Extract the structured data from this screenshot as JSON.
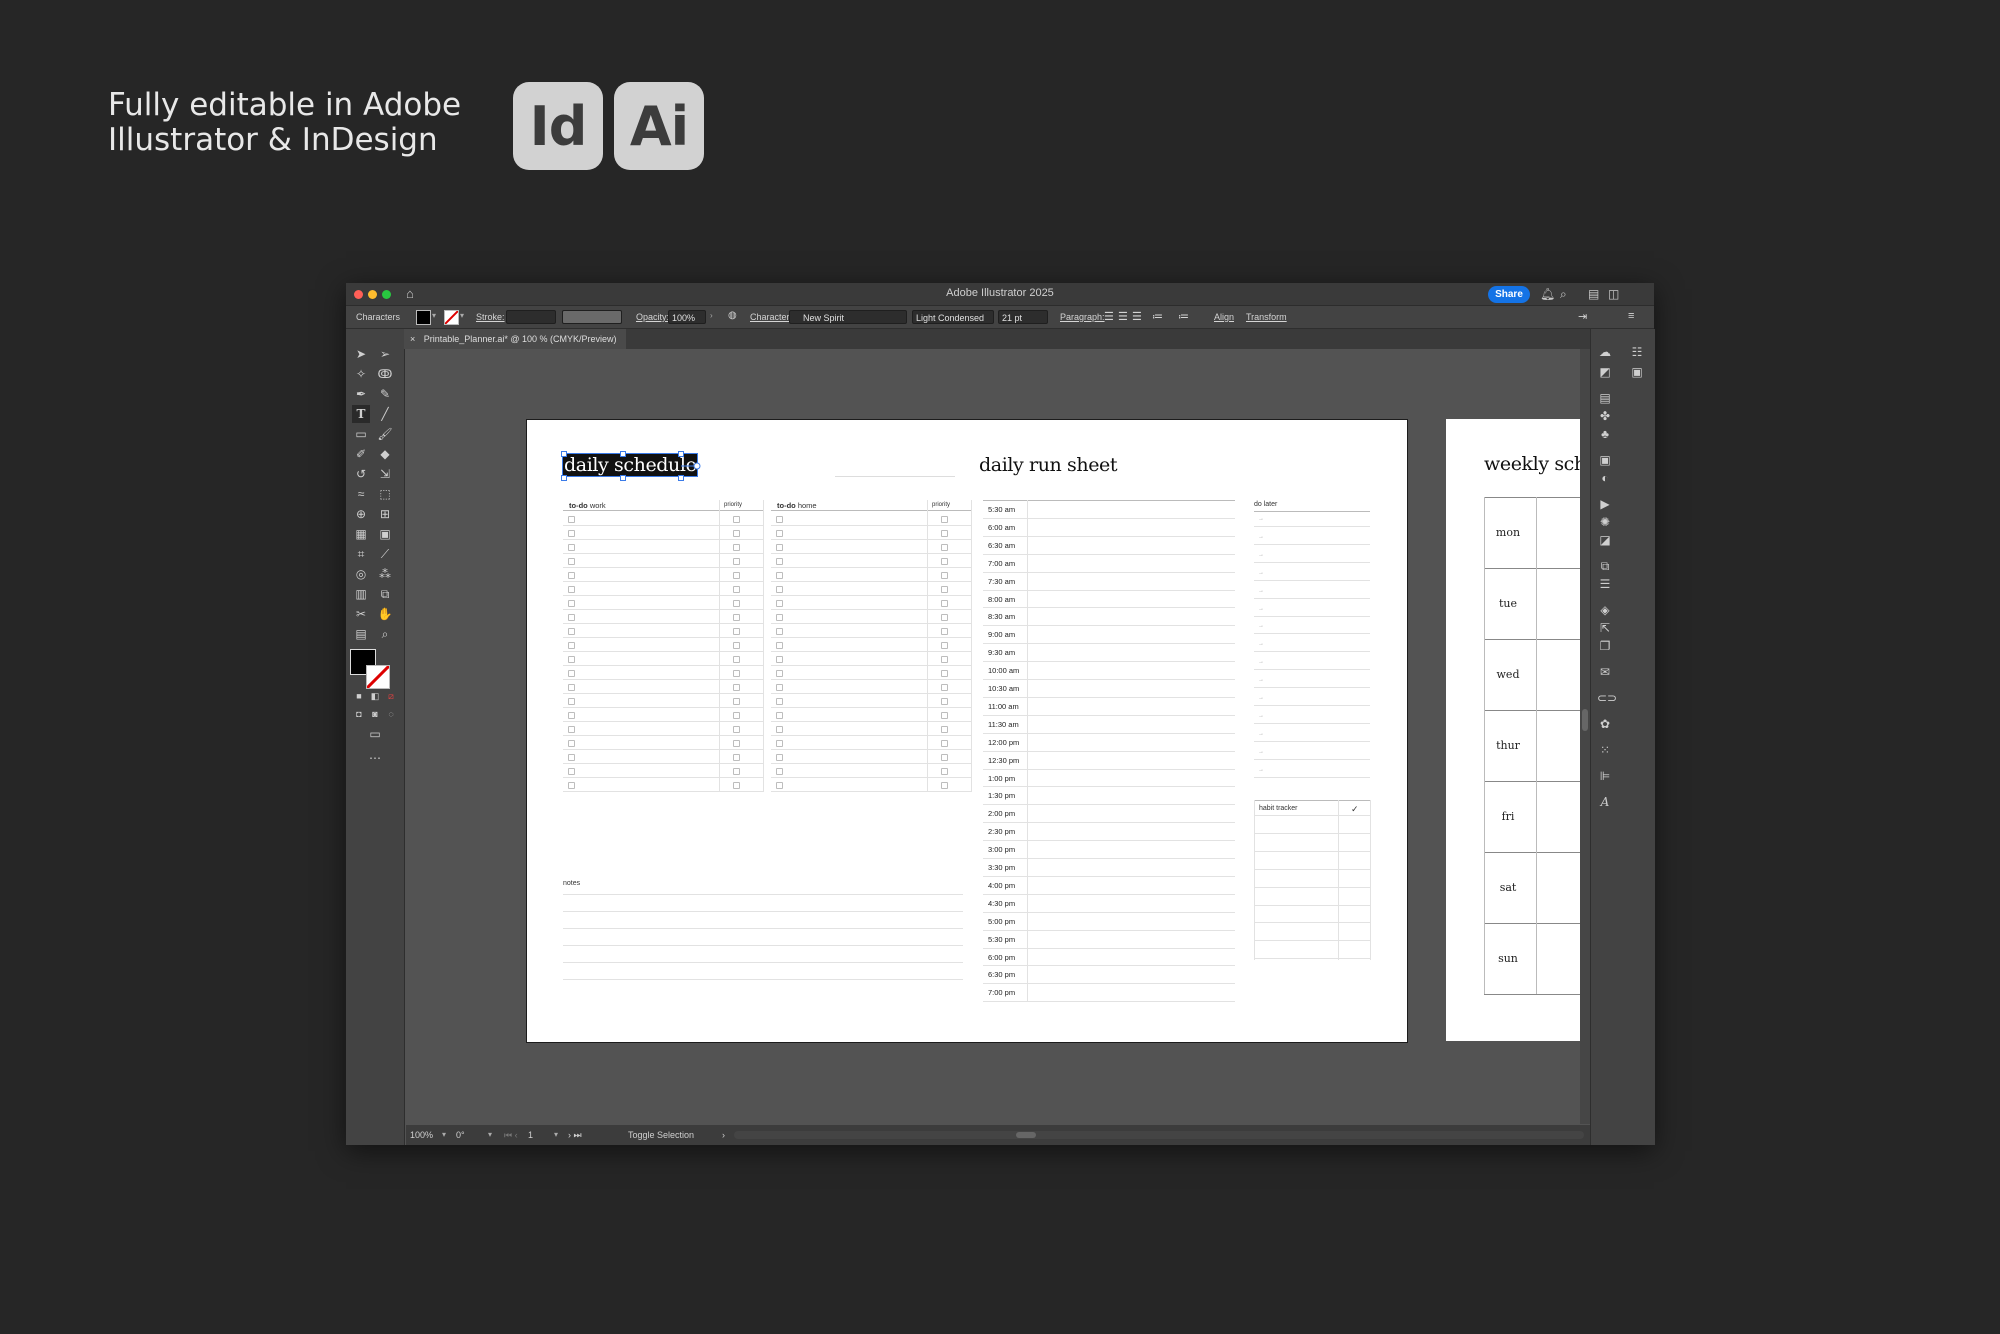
{
  "promo": {
    "line1": "Fully editable in Adobe",
    "line2": "Illustrator & InDesign"
  },
  "badges": {
    "indesign": "Id",
    "illustrator": "Ai"
  },
  "window": {
    "title": "Adobe Illustrator 2025",
    "share": "Share"
  },
  "control_bar": {
    "panel": "Characters",
    "stroke_label": "Stroke:",
    "opacity_label": "Opacity:",
    "opacity_value": "100%",
    "character_label": "Character:",
    "font_family": "New Spirit",
    "font_style": "Light Condensed",
    "font_size": "21 pt",
    "paragraph_label": "Paragraph:",
    "align": "Align",
    "transform": "Transform"
  },
  "document_tab": {
    "close": "×",
    "label": "Printable_Planner.ai* @ 100 % (CMYK/Preview)"
  },
  "status_bar": {
    "zoom": "100%",
    "rotation": "0°",
    "artboard": "1",
    "info": "Toggle Selection"
  },
  "artboard": {
    "title_left": "daily schedule",
    "title_right": "daily run sheet",
    "todo_work": {
      "bold": "to-do",
      "rest": " work"
    },
    "todo_home": {
      "bold": "to-do",
      "rest": " home"
    },
    "priority": "priority",
    "notes": "notes",
    "do_later": "do later",
    "habit_tracker": "habit tracker",
    "check": "✓",
    "times": [
      "5:30 am",
      "6:00 am",
      "6:30 am",
      "7:00 am",
      "7:30 am",
      "8:00 am",
      "8:30 am",
      "9:00 am",
      "9:30 am",
      "10:00 am",
      "10:30 am",
      "11:00 am",
      "11:30 am",
      "12:00 pm",
      "12:30 pm",
      "1:00 pm",
      "1:30 pm",
      "2:00 pm",
      "2:30 pm",
      "3:00 pm",
      "3:30 pm",
      "4:00 pm",
      "4:30 pm",
      "5:00 pm",
      "5:30 pm",
      "6:00 pm",
      "6:30 pm",
      "7:00 pm"
    ]
  },
  "artboard2": {
    "title": "weekly schedule",
    "days": [
      "mon",
      "tue",
      "wed",
      "thur",
      "fri",
      "sat",
      "sun"
    ]
  }
}
